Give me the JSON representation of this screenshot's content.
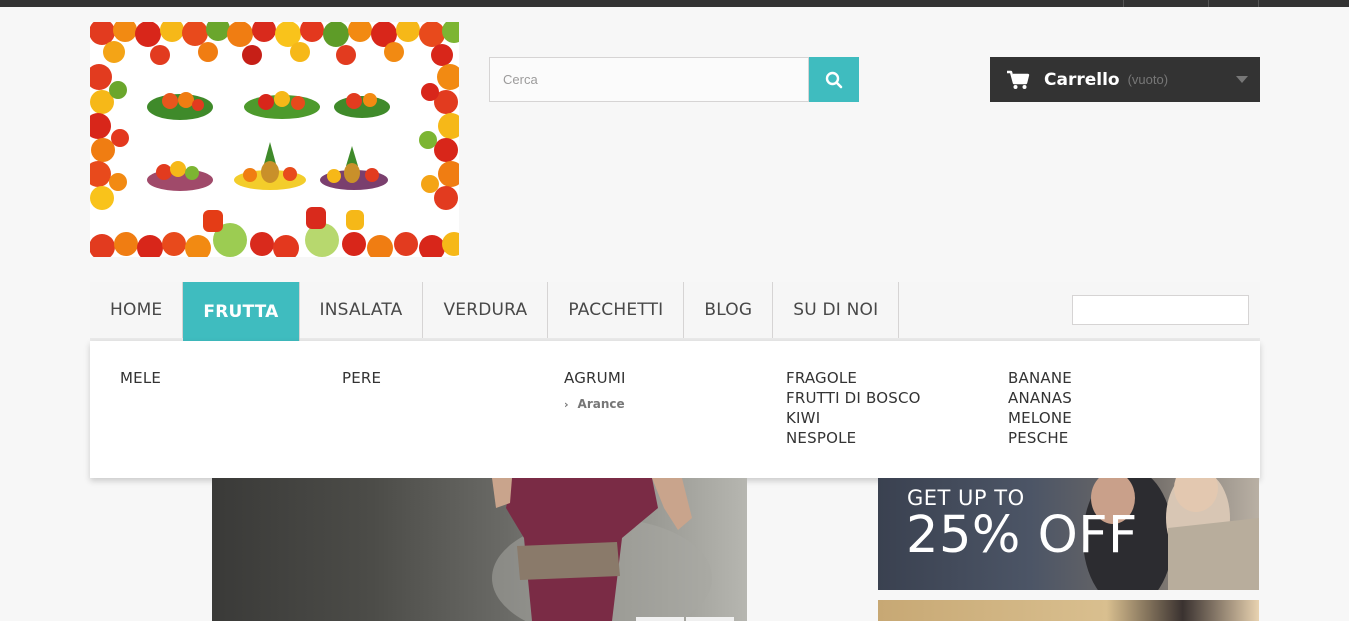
{
  "colors": {
    "accent": "#3fbcbf",
    "dark": "#333333",
    "text": "#333333",
    "muted": "#777777"
  },
  "search": {
    "placeholder": "Cerca",
    "icon": "search-icon"
  },
  "cart": {
    "title": "Carrello",
    "status": "(vuoto)",
    "icon": "cart-icon"
  },
  "nav": {
    "items": [
      {
        "label": "HOME"
      },
      {
        "label": "FRUTTA",
        "active": true
      },
      {
        "label": "INSALATA"
      },
      {
        "label": "VERDURA"
      },
      {
        "label": "PACCHETTI"
      },
      {
        "label": "BLOG"
      },
      {
        "label": "SU DI NOI"
      }
    ]
  },
  "dropdown": {
    "columns": [
      {
        "links": [
          "MELE"
        ]
      },
      {
        "links": [
          "PERE"
        ]
      },
      {
        "links": [
          "AGRUMI"
        ],
        "sub": [
          "Arance"
        ]
      },
      {
        "links": [
          "FRAGOLE",
          "FRUTTI DI BOSCO",
          "KIWI",
          "NESPOLE"
        ]
      },
      {
        "links": [
          "BANANE",
          "ANANAS",
          "MELONE",
          "PESCHE"
        ]
      }
    ]
  },
  "promo": {
    "line1": "GET UP TO",
    "line2": "25% OFF"
  }
}
